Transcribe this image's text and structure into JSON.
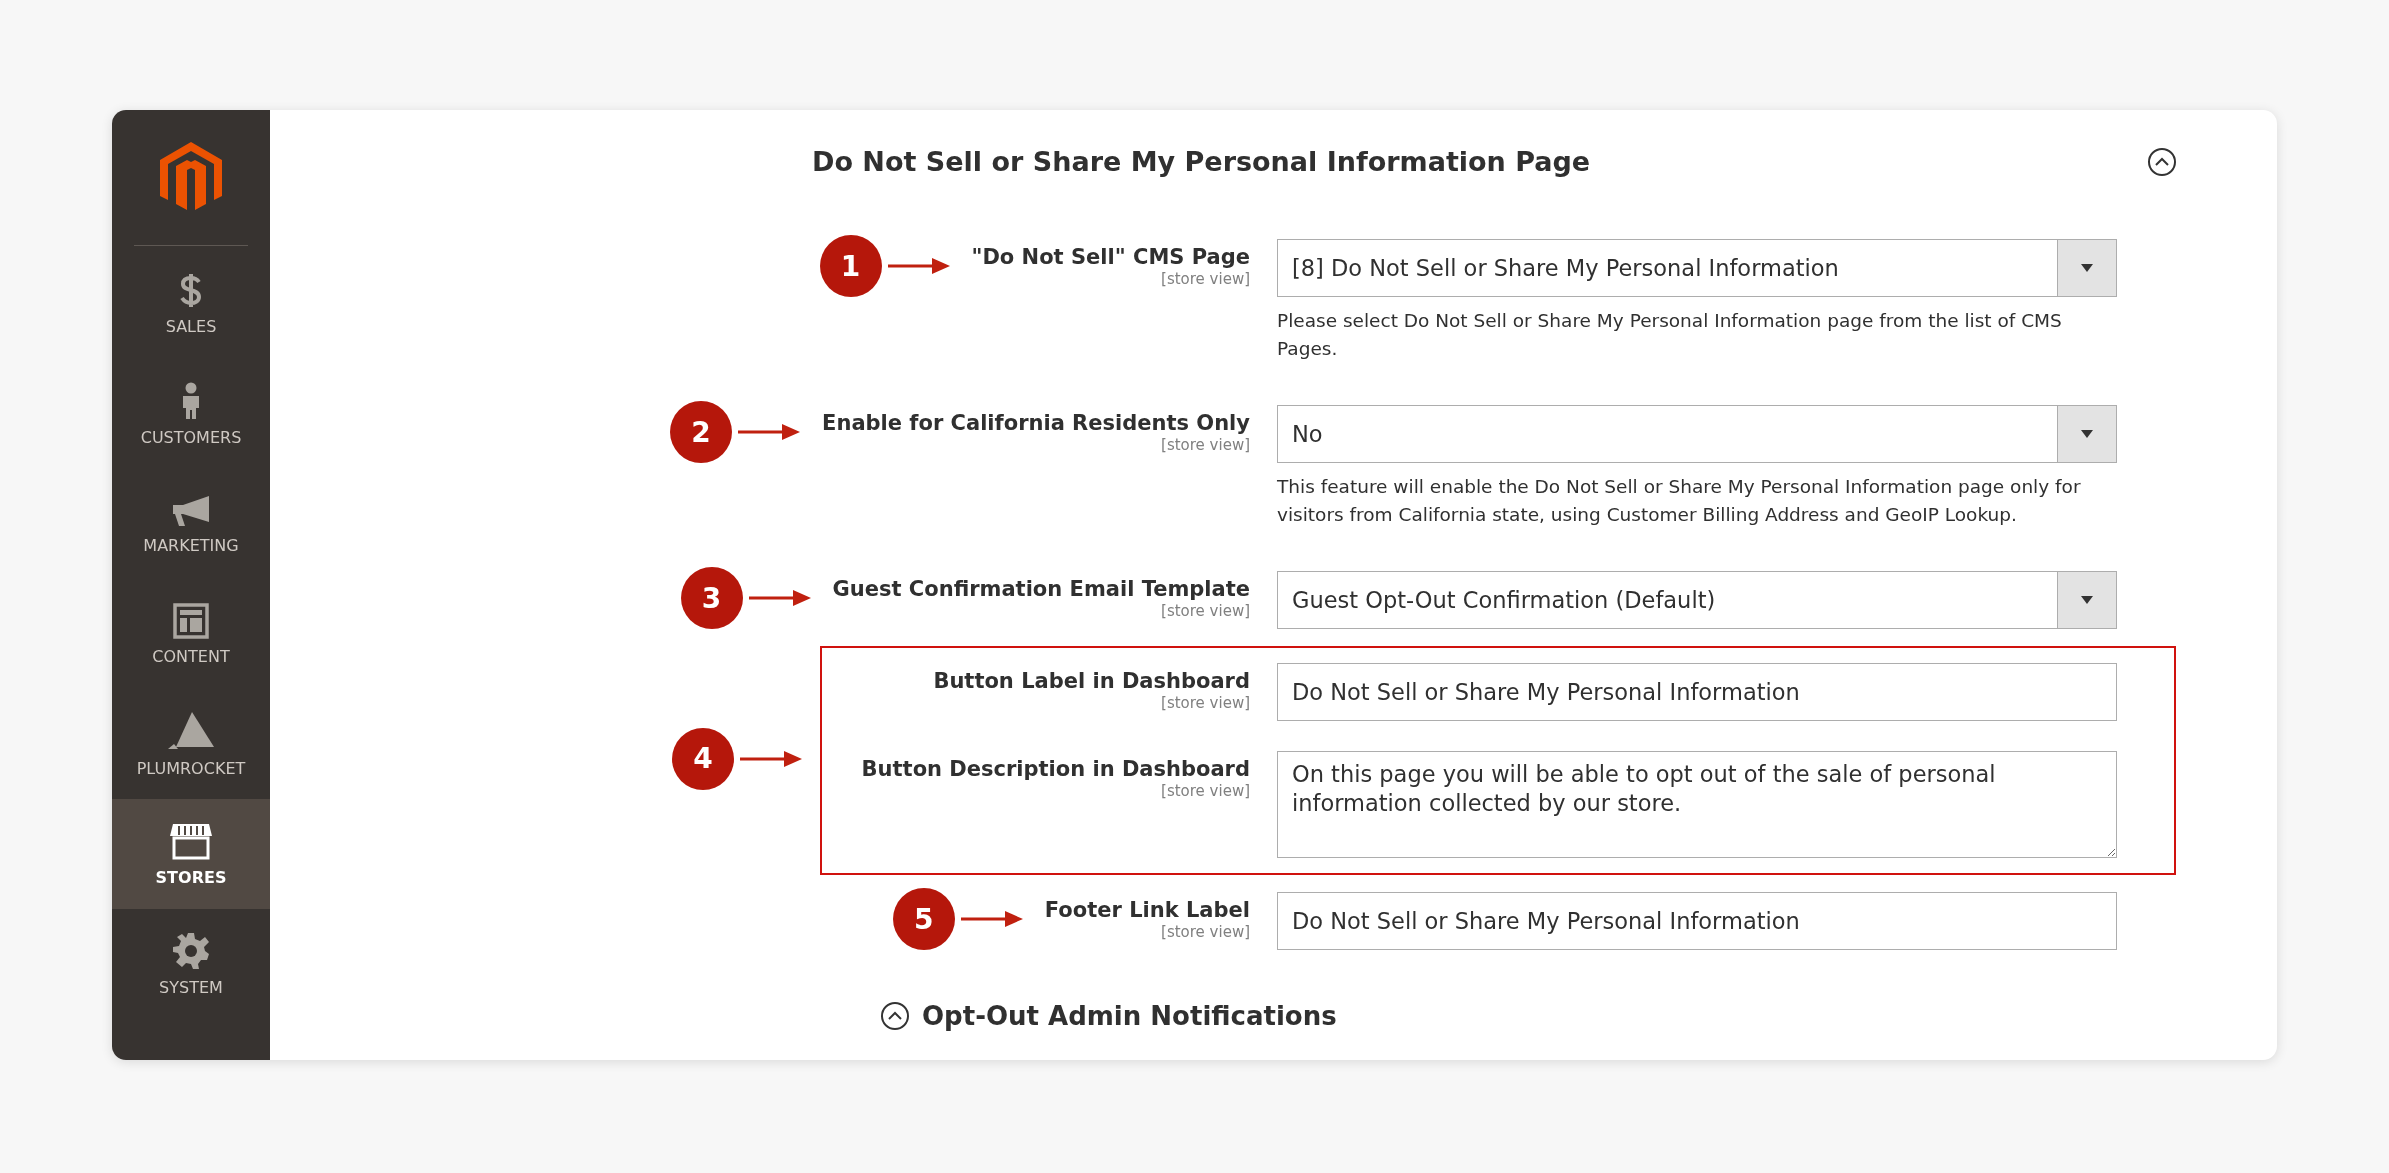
{
  "sidebar": {
    "items": [
      {
        "kind": "sales",
        "label": "SALES",
        "selected": false
      },
      {
        "kind": "customers",
        "label": "CUSTOMERS",
        "selected": false
      },
      {
        "kind": "marketing",
        "label": "MARKETING",
        "selected": false
      },
      {
        "kind": "content",
        "label": "CONTENT",
        "selected": false
      },
      {
        "kind": "plumrocket",
        "label": "PLUMROCKET",
        "selected": false
      },
      {
        "kind": "stores",
        "label": "STORES",
        "selected": true
      },
      {
        "kind": "system",
        "label": "SYSTEM",
        "selected": false
      }
    ]
  },
  "section": {
    "title": "Do Not Sell or Share My Personal Information Page",
    "expanded": true
  },
  "groups": [
    {
      "marker": "1",
      "highlighted": false,
      "fields": [
        {
          "kind": "select",
          "label": "\"Do Not Sell\" CMS Page",
          "scope": "[store view]",
          "value": "[8] Do Not Sell or Share My Personal Information",
          "note": "Please select Do Not Sell or Share My Personal Information page from the list of CMS Pages."
        }
      ]
    },
    {
      "marker": "2",
      "highlighted": false,
      "fields": [
        {
          "kind": "select",
          "label": "Enable for California Residents Only",
          "scope": "[store view]",
          "value": "No",
          "note": "This feature will enable the Do Not Sell or Share My Personal Information page only for visitors from California state, using Customer Billing Address and GeoIP Lookup."
        }
      ]
    },
    {
      "marker": "3",
      "highlighted": false,
      "fields": [
        {
          "kind": "select",
          "label": "Guest Confirmation Email Template",
          "scope": "[store view]",
          "value": "Guest Opt-Out Confirmation (Default)"
        }
      ]
    },
    {
      "marker": "4",
      "highlighted": true,
      "fields": [
        {
          "kind": "text",
          "label": "Button Label in Dashboard",
          "scope": "[store view]",
          "value": "Do Not Sell or Share My Personal Information"
        },
        {
          "kind": "textarea",
          "label": "Button Description in Dashboard",
          "scope": "[store view]",
          "value": "On this page you will be able to opt out of the sale of personal information collected by our store."
        }
      ]
    },
    {
      "marker": "5",
      "highlighted": false,
      "fields": [
        {
          "kind": "text",
          "label": "Footer Link Label",
          "scope": "[store view]",
          "value": "Do Not Sell or Share My Personal Information"
        }
      ]
    }
  ],
  "next_section": {
    "title": "Opt-Out Admin Notifications",
    "expanded": true
  }
}
